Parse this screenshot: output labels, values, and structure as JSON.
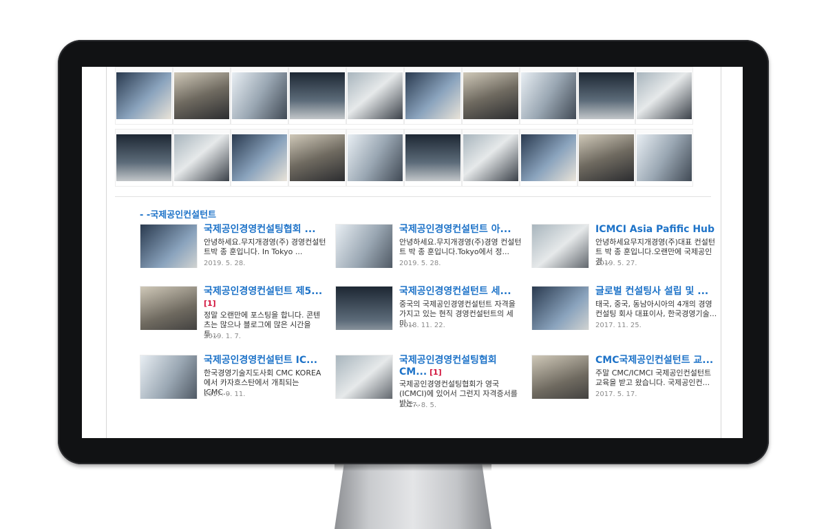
{
  "section": {
    "title": "- -국제공인컨설턴트"
  },
  "posts": [
    {
      "title": "국제공인경영컨설팅협회 ...",
      "badge": "",
      "desc": "안녕하세요.무지개경영(주) 경영컨설턴트박 종 훈입니다. In Tokyo ...",
      "date": "2019. 5. 28."
    },
    {
      "title": "국제공인경영컨설턴트 아...",
      "badge": "",
      "desc": "안녕하세요.무지개경영(주)경영 컨설턴트 박 종 훈입니다.Tokyo에서 정...",
      "date": "2019. 5. 28."
    },
    {
      "title": "ICMCI Asia Pafific Hub ...",
      "badge": "",
      "desc": "안녕하세요무지개경영(주)대표 컨설턴트 박 종 훈입니다.오랜만에 국제공인경...",
      "date": "2019. 5. 27."
    },
    {
      "title": "국제공인경영컨설턴트 제5...",
      "badge": "[1]",
      "desc": "정말 오랜만에 포스팅을 합니다. 콘텐츠는 많으나 블로그에 많은 시간을 투...",
      "date": "2019. 1. 7."
    },
    {
      "title": "국제공인경영컨설턴트 세...",
      "badge": "",
      "desc": "중국의 국제공인경영컨설턴트 자격을 가지고 있는 현직 경영컨설턴트의 세미...",
      "date": "2018. 11. 22."
    },
    {
      "title": "글로벌 컨설팅사 설립 및 ...",
      "badge": "",
      "desc": "태국, 중국, 동남아시아의 4개의 경영컨설팅 회사 대표이사, 한국경영기술...",
      "date": "2017. 11. 25."
    },
    {
      "title": "국제공인경영컨설턴트 IC...",
      "badge": "",
      "desc": "한국경영기술지도사회 CMC KOREA에서 카자흐스탄에서 개최되는 ICMC...",
      "date": "2017. 9. 11."
    },
    {
      "title": "국제공인경영컨설팅협회CM...",
      "badge": "[1]",
      "desc": "국제공인경영컨설팅협회가 영국(ICMCI)에 있어서 그런지 자격증서를 받는...",
      "date": "2017. 8. 5."
    },
    {
      "title": "CMC국제공인컨설턴트 교...",
      "badge": "",
      "desc": "주말 CMC/ICMCI 국제공인컨설턴트 교육을 받고 왔습니다. 국제공인컨...",
      "date": "2017. 5. 17."
    }
  ],
  "gallery": {
    "rows": 2,
    "per_row": 10
  }
}
